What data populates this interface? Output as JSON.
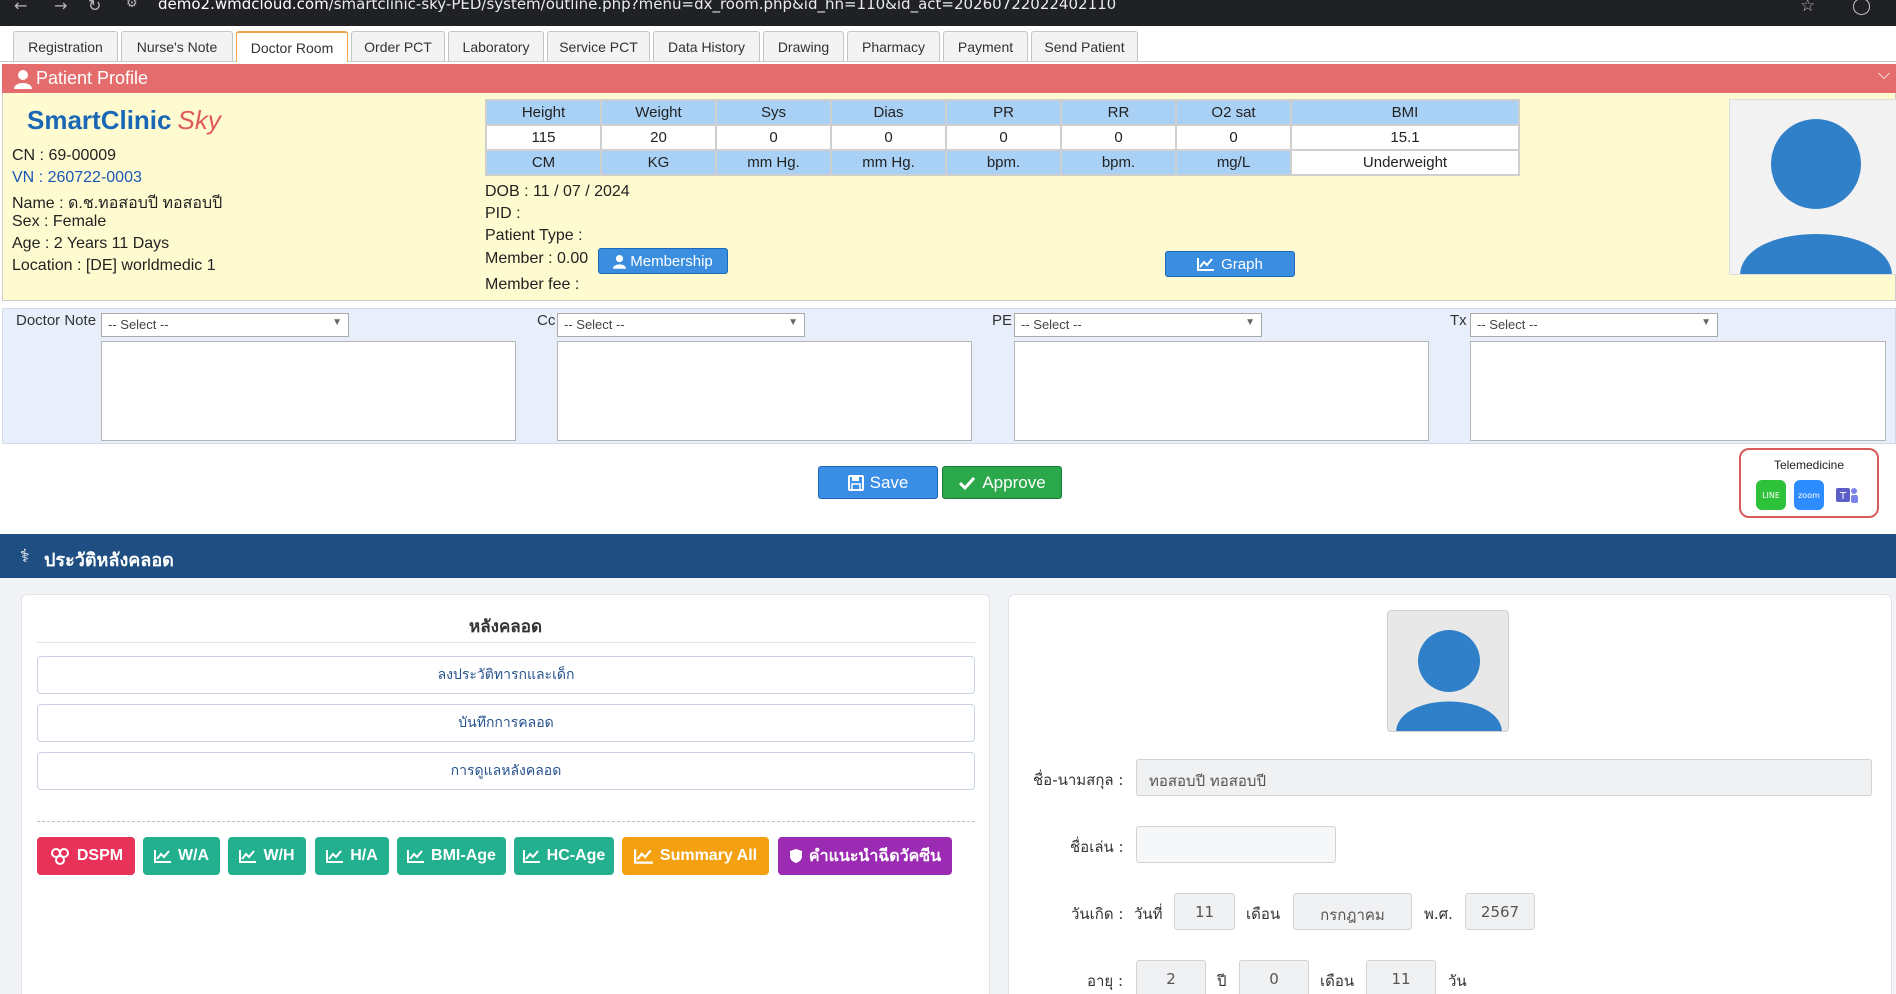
{
  "browser": {
    "url_host": "demo2.wmdcloud.com",
    "url_path": "/smartclinic-sky-PED/system/outline.php?menu=dx_room.php&id_hn=110&id_act=20260722022402110"
  },
  "tabs": [
    {
      "label": "Registration"
    },
    {
      "label": "Nurse's Note"
    },
    {
      "label": "Doctor Room"
    },
    {
      "label": "Order PCT"
    },
    {
      "label": "Laboratory"
    },
    {
      "label": "Service PCT"
    },
    {
      "label": "Data History"
    },
    {
      "label": "Drawing"
    },
    {
      "label": "Pharmacy"
    },
    {
      "label": "Payment"
    },
    {
      "label": "Send Patient"
    }
  ],
  "active_tab": "Doctor Room",
  "profile": {
    "title": "Patient Profile",
    "logo_main": "SmartClinic",
    "logo_sub": "Sky",
    "cn": "CN : 69-00009",
    "vn": "VN : 260722-0003",
    "name": "Name : ด.ช.ทอสอบปี ทอสอบปี",
    "sex": "Sex : Female",
    "age": "Age : 2 Years 11 Days",
    "location": "Location : [DE] worldmedic 1",
    "dob": "DOB : 11 / 07 / 2024",
    "pid": "PID :",
    "patient_type": "Patient Type :",
    "member": "Member : 0.00",
    "member_fee": "Member fee :",
    "membership_btn": "Membership",
    "graph_btn": "Graph"
  },
  "vitals": {
    "headers": [
      "Height",
      "Weight",
      "Sys",
      "Dias",
      "PR",
      "RR",
      "O2 sat",
      "BMI"
    ],
    "values": [
      "115",
      "20",
      "0",
      "0",
      "0",
      "0",
      "0",
      "15.1"
    ],
    "units": [
      "CM",
      "KG",
      "mm Hg.",
      "mm Hg.",
      "bpm.",
      "bpm.",
      "mg/L",
      "Underweight"
    ]
  },
  "notes": {
    "doctor_note_label": "Doctor Note",
    "cc_label": "Cc",
    "pe_label": "PE",
    "tx_label": "Tx",
    "select_placeholder": "-- Select --"
  },
  "actions": {
    "save": "Save",
    "approve": "Approve",
    "telemedicine": "Telemedicine",
    "line": "LINE",
    "zoom": "zoom",
    "teams": "MS Teams"
  },
  "history": {
    "title": "ประวัติหลังคลอด",
    "panel_title": "หลังคลอด",
    "links": [
      "ลงประวัติทารกและเด็ก",
      "บันทึกการคลอด",
      "การดูแลหลังคลอด"
    ],
    "chips": [
      {
        "label": "DSPM",
        "color": "#e8325a"
      },
      {
        "label": "W/A",
        "color": "#22b08f"
      },
      {
        "label": "W/H",
        "color": "#22b08f"
      },
      {
        "label": "H/A",
        "color": "#22b08f"
      },
      {
        "label": "BMI-Age",
        "color": "#22b08f"
      },
      {
        "label": "HC-Age",
        "color": "#22b08f"
      },
      {
        "label": "Summary All",
        "color": "#f5a011"
      },
      {
        "label": "คำแนะนำฉีดวัคซีน",
        "color": "#9c2bb3"
      }
    ]
  },
  "form": {
    "fullname_label": "ชื่อ-นามสกุล :",
    "fullname_value": "ทอสอบปี ทอสอบปี",
    "nickname_label": "ชื่อเล่น :",
    "nickname_value": "",
    "birth_label": "วันเกิด :",
    "day_label": "วันที่",
    "day_value": "11",
    "month_label": "เดือน",
    "month_value": "กรกฎาคม",
    "year_label": "พ.ศ.",
    "year_value": "2567",
    "age_label": "อายุ :",
    "age_years": "2",
    "years_unit": "ปี",
    "age_months": "0",
    "months_unit": "เดือน",
    "age_days": "11",
    "days_unit": "วัน"
  },
  "colors": {
    "profile_header": "#e46c6c",
    "history_header": "#1f4f82",
    "primary": "#3a8ee6",
    "success": "#2aa84a"
  }
}
